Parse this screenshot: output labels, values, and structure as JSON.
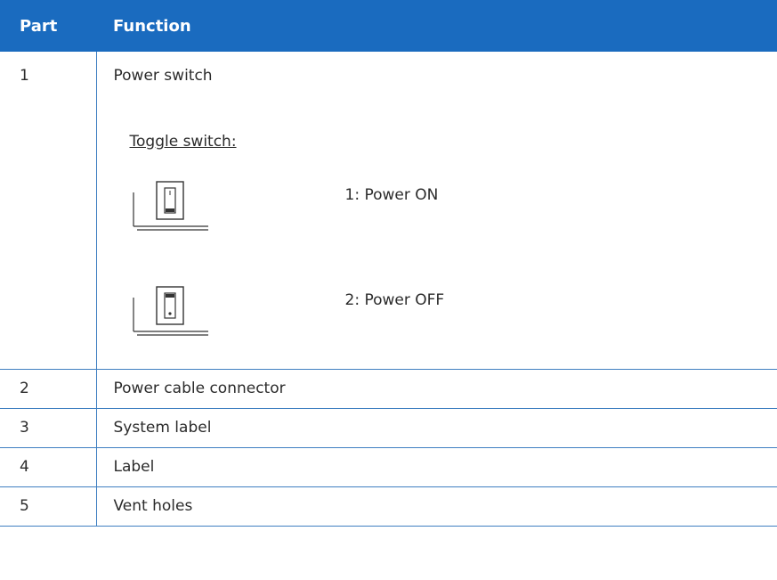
{
  "table": {
    "headers": {
      "part": "Part",
      "function": "Function"
    },
    "rows": [
      {
        "part": "1",
        "function": "Power switch",
        "toggle_heading": "Toggle switch:",
        "states": [
          {
            "label": "1: Power ON",
            "icon": "toggle-switch-on-icon"
          },
          {
            "label": "2: Power OFF",
            "icon": "toggle-switch-off-icon"
          }
        ]
      },
      {
        "part": "2",
        "function": "Power cable connector"
      },
      {
        "part": "3",
        "function": "System label"
      },
      {
        "part": "4",
        "function": "Label"
      },
      {
        "part": "5",
        "function": "Vent holes"
      }
    ]
  },
  "colors": {
    "header_background": "#1a6bbf",
    "header_text": "#ffffff",
    "border": "#3f7fc1"
  }
}
